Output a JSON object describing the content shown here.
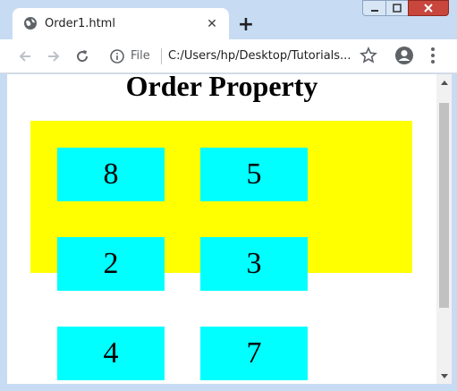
{
  "window": {
    "tab_title": "Order1.html",
    "tab_close": "✕",
    "new_tab": "+"
  },
  "toolbar": {
    "file_label": "File",
    "url": "C:/Users/hp/Desktop/Tutorials..."
  },
  "page": {
    "heading": "Order Property",
    "items": [
      "8",
      "5",
      "2",
      "3",
      "4",
      "7"
    ]
  },
  "colors": {
    "container_bg": "#ffff00",
    "item_bg": "#00ffff",
    "window_frame": "#c7dcf3",
    "close_button": "#c9463d"
  },
  "icons": {
    "tab": "globe-icon",
    "back": "arrow-left-icon",
    "forward": "arrow-right-icon",
    "reload": "reload-icon",
    "info": "info-icon",
    "bookmark": "star-icon",
    "account": "account-icon",
    "menu": "kebab-menu-icon"
  }
}
